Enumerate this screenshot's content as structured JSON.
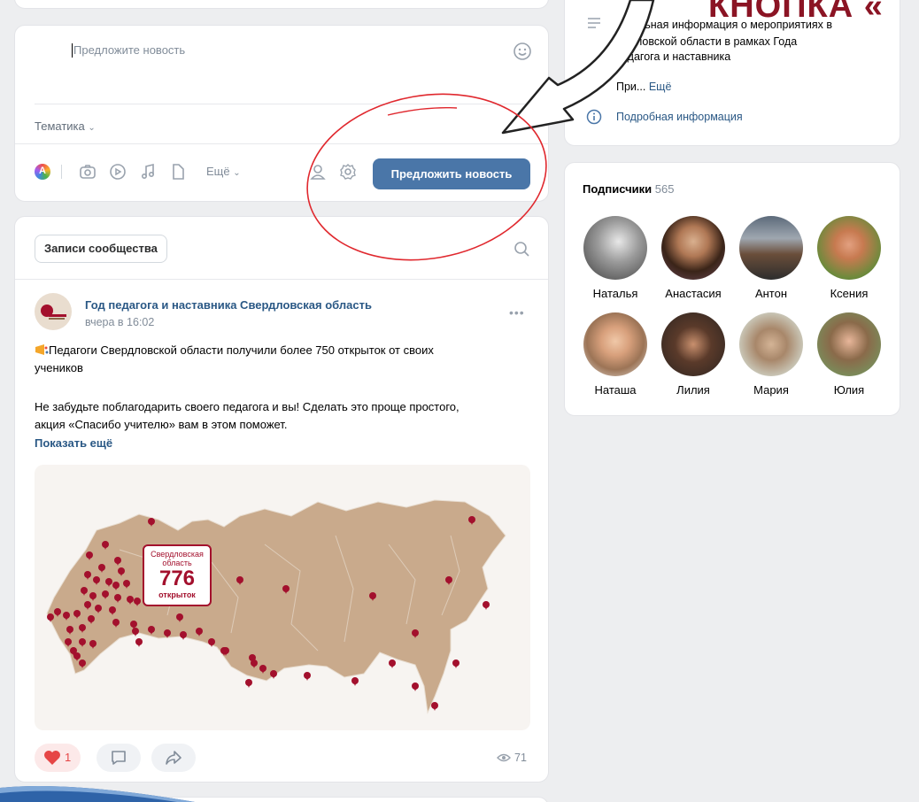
{
  "composer": {
    "placeholder": "Предложите новость",
    "topic_label": "Тематика",
    "more_label": "Ещё",
    "submit_label": "Предложить новость"
  },
  "info": {
    "line1": "альная информация о мероприятиях в",
    "line2": "рдловской области в рамках Года",
    "line3": "едагога и наставника",
    "more_prefix": "При...",
    "more_link": "Ещё",
    "details_link": "Подробная информация"
  },
  "banner_text": "КНОПКА «",
  "subscribers": {
    "title": "Подписчики",
    "count": "565",
    "people": [
      "Наталья",
      "Анастасия",
      "Антон",
      "Ксения",
      "Наташа",
      "Лилия",
      "Мария",
      "Юлия"
    ]
  },
  "feed": {
    "tab_label": "Записи сообщества"
  },
  "post": {
    "author": "Год педагога и наставника Свердловская область",
    "time": "вчера в 16:02",
    "text_line1": "Педагоги Свердловской области получили более 750 открыток от своих",
    "text_line2": "учеников",
    "text_line3": "Не забудьте поблагодарить своего педагога и вы! Сделать это проще простого,",
    "text_line4": "акция «Спасибо учителю» вам в этом поможет.",
    "show_more": "Показать ещё",
    "likes": "1",
    "views": "71",
    "map_label_top": "Свердловская область",
    "map_number": "776",
    "map_label_bottom": "открыток"
  },
  "colors": {
    "accent": "#4a76a8",
    "link": "#2a5885",
    "like_red": "#e64646",
    "annotation_red": "#e0282e",
    "banner": "#8b1424",
    "map_land": "#c9aa8c",
    "pin": "#a3102d"
  },
  "icons": [
    "emoji-icon",
    "palette-icon",
    "camera-icon",
    "video-icon",
    "music-icon",
    "document-icon",
    "author-icon",
    "settings-icon",
    "search-icon",
    "more-icon",
    "heart-icon",
    "comment-icon",
    "share-icon",
    "eye-icon",
    "menu-icon",
    "info-icon"
  ]
}
